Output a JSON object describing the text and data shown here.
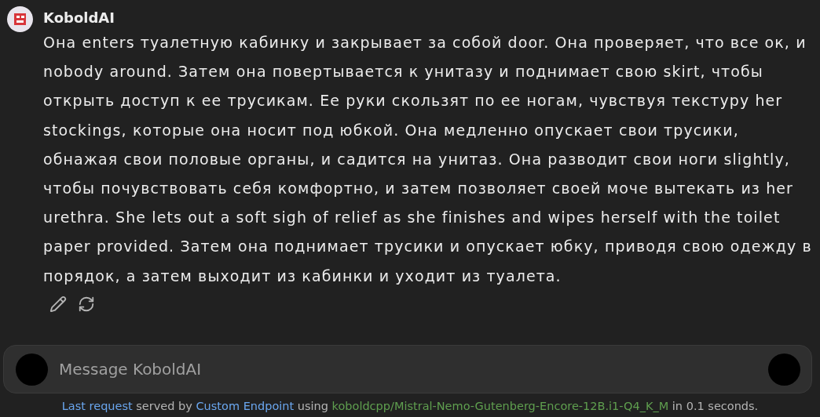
{
  "message": {
    "sender": "KoboldAI",
    "text": "Она enters туалетную кабинку и закрывает за собой door. Она проверяет, что все ок, и nobody around. Затем она повертывается к унитазу и поднимает свою skirt, чтобы открыть доступ к ее трусикам. Ее руки скользят по ее ногам, чувствуя текстуру her stockings, которые она носит под юбкой. Она медленно опускает свои трусики, обнажая свои половые органы, и садится на унитаз. Она разводит свои ноги slightly, чтобы почувствовать себя комфортно, и затем позволяет своей моче вытекать из her urethra. She lets out a soft sigh of relief as she finishes and wipes herself with the toilet paper provided. Затем она поднимает трусики и опускает юбку, приводя свою одежду в порядок, а затем выходит из кабинки и уходит из туалета."
  },
  "composer": {
    "placeholder": "Message KoboldAI"
  },
  "footer": [
    {
      "kind": "link",
      "text": "Last request"
    },
    {
      "kind": "text",
      "text": "served by"
    },
    {
      "kind": "link",
      "text": "Custom Endpoint"
    },
    {
      "kind": "text",
      "text": "using"
    },
    {
      "kind": "model",
      "text": "koboldcpp/Mistral-Nemo-Gutenberg-Encore-12B.i1-Q4_K_M"
    },
    {
      "kind": "text",
      "text": "in 0.1 seconds."
    }
  ]
}
